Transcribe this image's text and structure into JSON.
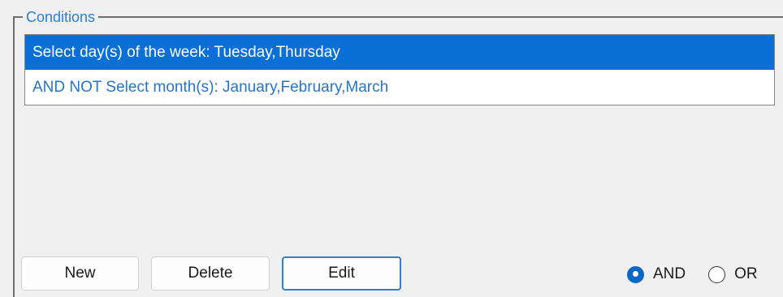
{
  "group": {
    "title": "Conditions"
  },
  "conditions": {
    "items": [
      {
        "label": "Select day(s) of the week: Tuesday,Thursday",
        "selected": true
      },
      {
        "label": "AND NOT Select month(s): January,February,March",
        "selected": false
      }
    ]
  },
  "buttons": {
    "new_label": "New",
    "delete_label": "Delete",
    "edit_label": "Edit"
  },
  "logic": {
    "and_label": "AND",
    "or_label": "OR",
    "selected": "AND"
  },
  "colors": {
    "selection": "#0a6fd6",
    "accent_text": "#2474c9"
  }
}
